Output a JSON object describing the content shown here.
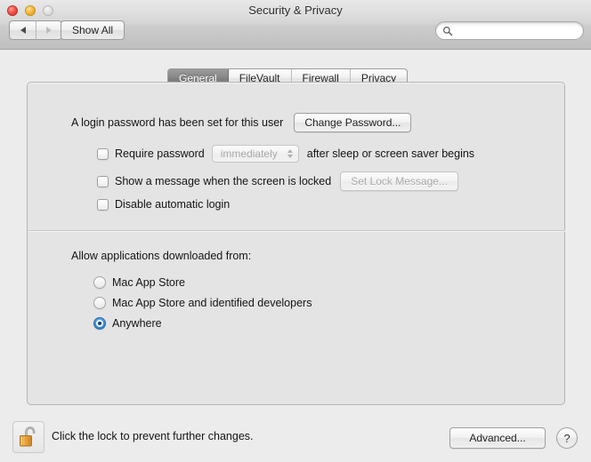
{
  "window": {
    "title": "Security & Privacy",
    "traffic_lights": [
      "close",
      "minimize",
      "zoom"
    ]
  },
  "toolbar": {
    "back_icon": "triangle-left-icon",
    "forward_icon": "triangle-right-icon",
    "show_all_label": "Show All",
    "search": {
      "icon": "search-icon",
      "value": "",
      "placeholder": ""
    }
  },
  "tabs": [
    {
      "label": "General",
      "active": true
    },
    {
      "label": "FileVault",
      "active": false
    },
    {
      "label": "Firewall",
      "active": false
    },
    {
      "label": "Privacy",
      "active": false
    }
  ],
  "general": {
    "login_status_text": "A login password has been set for this user",
    "change_password_label": "Change Password...",
    "require_password": {
      "checked": false,
      "prefix_label": "Require password",
      "delay_value": "immediately",
      "suffix_label": "after sleep or screen saver begins",
      "enabled": false
    },
    "lock_message": {
      "checked": false,
      "label": "Show a message when the screen is locked",
      "button_label": "Set Lock Message...",
      "button_enabled": false
    },
    "disable_auto_login": {
      "checked": false,
      "label": "Disable automatic login"
    },
    "allow_apps": {
      "group_label": "Allow applications downloaded from:",
      "options": [
        {
          "label": "Mac App Store",
          "selected": false
        },
        {
          "label": "Mac App Store and identified developers",
          "selected": false
        },
        {
          "label": "Anywhere",
          "selected": true
        }
      ]
    }
  },
  "footer": {
    "lock_icon": "unlocked-padlock-icon",
    "lock_text": "Click the lock to prevent further changes.",
    "advanced_label": "Advanced...",
    "help_label": "?"
  },
  "colors": {
    "accent_blue": "#3f93dd",
    "window_bg": "#ececec",
    "panel_bg": "#e4e4e4",
    "active_tab_bg": "#868686",
    "lock_gold": "#e8a33d"
  }
}
